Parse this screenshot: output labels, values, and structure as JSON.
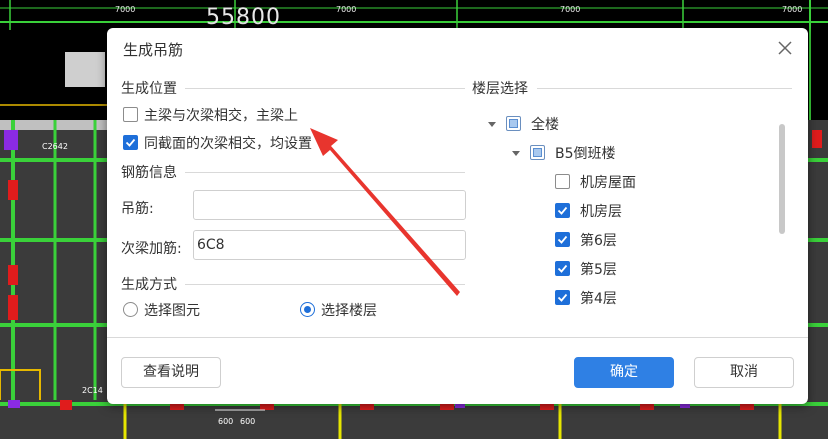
{
  "cad": {
    "dims": [
      "7000",
      "7000",
      "7000",
      "7000"
    ],
    "big_number": "55800",
    "labels": [
      "C2642",
      "2C14",
      "600",
      "600"
    ]
  },
  "dialog": {
    "title": "生成吊筋",
    "position_section": {
      "title": "生成位置",
      "opt_main_secondary": {
        "label": "主梁与次梁相交，主梁上",
        "checked": false
      },
      "opt_same_section": {
        "label": "同截面的次梁相交，均设置",
        "checked": true
      }
    },
    "rebar_section": {
      "title": "钢筋信息",
      "hanger_label": "吊筋:",
      "hanger_value": "",
      "secondary_label": "次梁加筋:",
      "secondary_value": "6C8"
    },
    "method_section": {
      "title": "生成方式",
      "opt_select_element": {
        "label": "选择图元",
        "checked": false
      },
      "opt_select_floor": {
        "label": "选择楼层",
        "checked": true
      }
    },
    "floor_section": {
      "title": "楼层选择",
      "tree": [
        {
          "label": "全楼",
          "state": "partial"
        },
        {
          "label": "B5倒班楼",
          "state": "partial"
        },
        {
          "label": "机房屋面",
          "state": "unchecked"
        },
        {
          "label": "机房层",
          "state": "checked"
        },
        {
          "label": "第6层",
          "state": "checked"
        },
        {
          "label": "第5层",
          "state": "checked"
        },
        {
          "label": "第4层",
          "state": "checked"
        }
      ]
    },
    "buttons": {
      "help": "查看说明",
      "ok": "确定",
      "cancel": "取消"
    },
    "colors": {
      "primary": "#2f80e4",
      "checkbox_checked": "#1e6fd9",
      "annotation_arrow": "#e8352e"
    }
  }
}
